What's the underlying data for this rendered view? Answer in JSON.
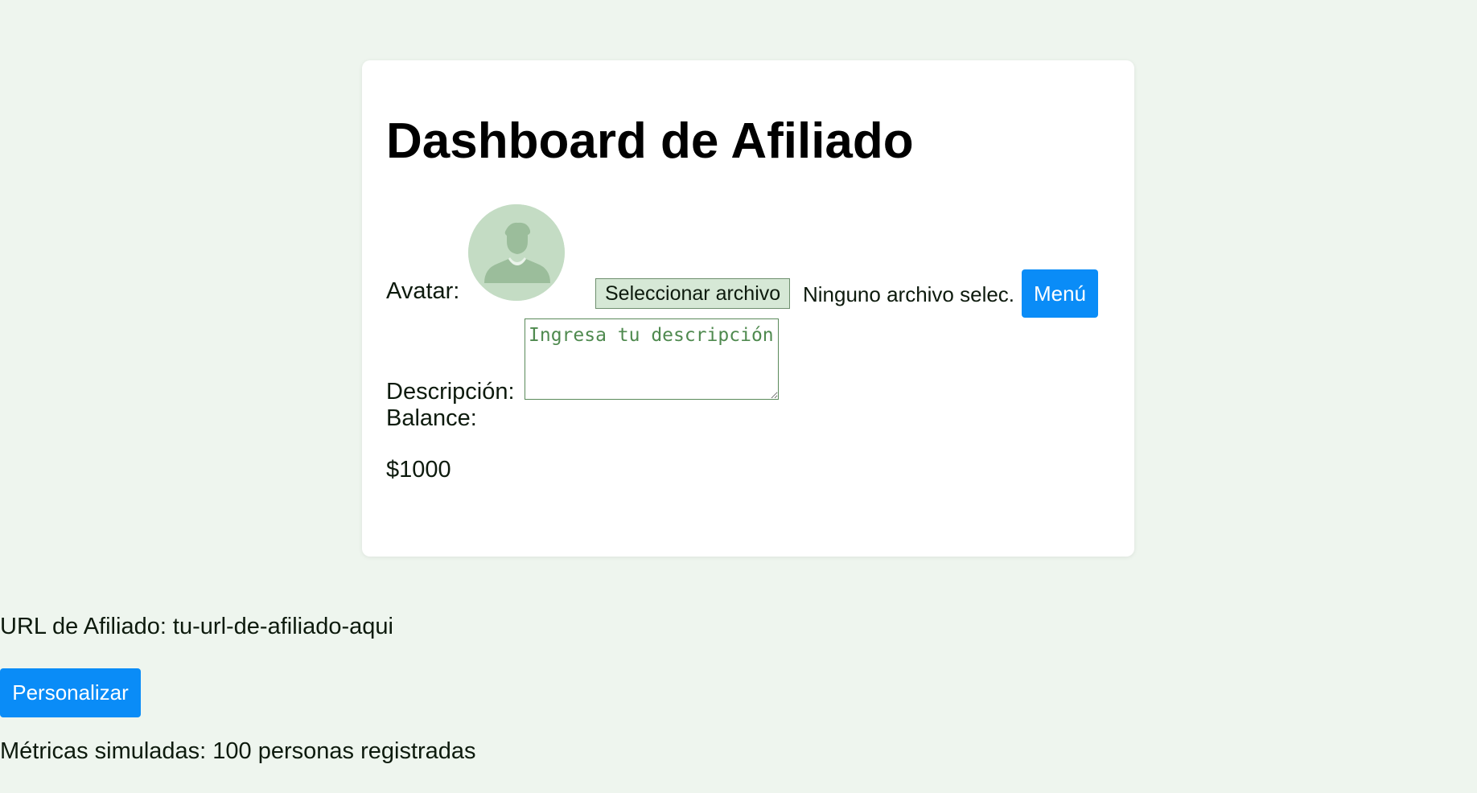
{
  "page": {
    "background": "#eef5ee",
    "title": "Dashboard de Afiliado"
  },
  "profile": {
    "avatar_label": "Avatar:",
    "avatar_icon": "user-silhouette-icon",
    "file_button_label": "Seleccionar archivo",
    "file_status": "Ninguno archivo selec.",
    "menu_button_label": "Menú",
    "description_label": "Descripción:",
    "description_value": "",
    "description_placeholder": "Ingresa tu descripción",
    "balance_label": "Balance:",
    "balance_value": "$1000"
  },
  "affiliate": {
    "url_text": "URL de Afiliado: tu-url-de-afiliado-aqui",
    "personalize_button_label": "Personalizar",
    "metrics_text": "Métricas simuladas: 100 personas registradas"
  },
  "colors": {
    "accent": "#0a8cf7",
    "avatar_bg": "#c4dcc4",
    "avatar_figure": "#9bbd9b",
    "file_button_bg": "#d6e8d6",
    "placeholder": "#4f8a4f"
  }
}
